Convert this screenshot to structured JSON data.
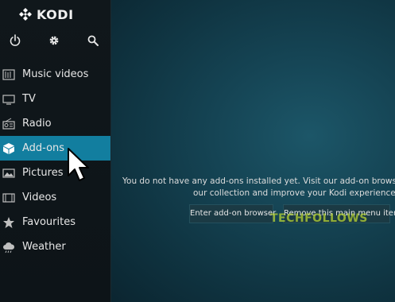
{
  "app": {
    "name": "KODI"
  },
  "top_icons": [
    {
      "name": "power-icon"
    },
    {
      "name": "gear-icon"
    },
    {
      "name": "search-icon"
    }
  ],
  "menu": [
    {
      "label": "Music videos",
      "icon": "music-video-icon",
      "active": false
    },
    {
      "label": "TV",
      "icon": "tv-icon",
      "active": false
    },
    {
      "label": "Radio",
      "icon": "radio-icon",
      "active": false
    },
    {
      "label": "Add-ons",
      "icon": "box-icon",
      "active": true
    },
    {
      "label": "Pictures",
      "icon": "picture-icon",
      "active": false
    },
    {
      "label": "Videos",
      "icon": "film-icon",
      "active": false
    },
    {
      "label": "Favourites",
      "icon": "star-icon",
      "active": false
    },
    {
      "label": "Weather",
      "icon": "cloud-icon",
      "active": false
    }
  ],
  "main": {
    "message_line1": "You do not have any add-ons installed yet. Visit our add-on browser to b",
    "message_line2": "our collection and improve your Kodi experience.",
    "enter_button": "Enter add-on browser",
    "remove_button": "Remove this main menu item"
  },
  "watermark": "TECHFOLLOWS",
  "colors": {
    "accent": "#127e9f",
    "sidebar_bg": "#10171b",
    "main_bg": "#154454",
    "text": "#e6e6e6"
  }
}
